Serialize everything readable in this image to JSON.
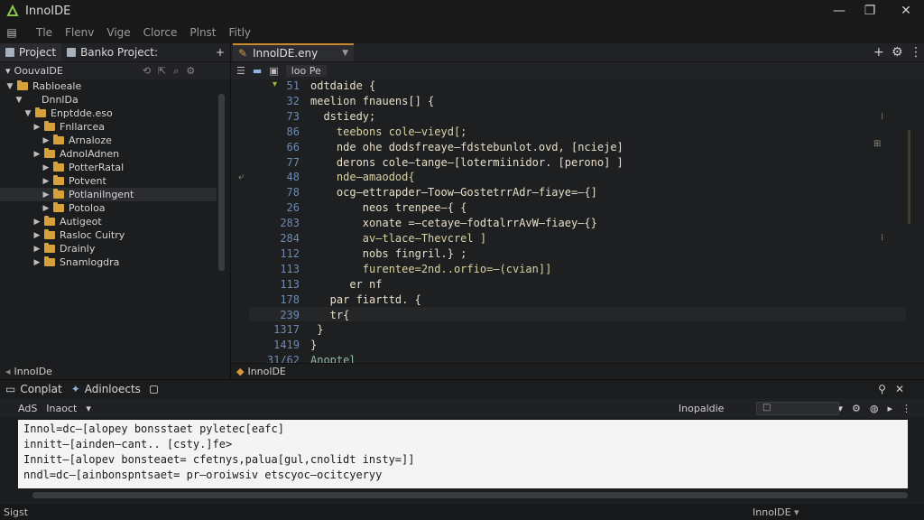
{
  "app": {
    "title": "InnoIDE"
  },
  "window": {
    "minimize": "—",
    "maximize": "❐",
    "close": "✕"
  },
  "menu": {
    "items": [
      "Tle",
      "Flenv",
      "Vige",
      "Clorce",
      "Plnst",
      "Fitly"
    ]
  },
  "left_panel": {
    "tabs": [
      {
        "label": "Project"
      },
      {
        "label": "Banko Project:"
      }
    ],
    "selector": "OouvaIDE",
    "tree": [
      {
        "label": "Rabloeale",
        "depth": 0,
        "arrow": "▼",
        "folder": true
      },
      {
        "label": "DnnlDa",
        "depth": 1,
        "arrow": "▼",
        "folder": false
      },
      {
        "label": "Enptdde.eso",
        "depth": 2,
        "arrow": "▼",
        "folder": true
      },
      {
        "label": "Fnllarcea",
        "depth": 3,
        "arrow": "▶",
        "folder": true
      },
      {
        "label": "Arnaloze",
        "depth": 4,
        "arrow": "▶",
        "folder": true
      },
      {
        "label": "AdnolAdnen",
        "depth": 3,
        "arrow": "▶",
        "folder": true
      },
      {
        "label": "PotterRatal",
        "depth": 4,
        "arrow": "▶",
        "folder": true
      },
      {
        "label": "Potvent",
        "depth": 4,
        "arrow": "▶",
        "folder": true
      },
      {
        "label": "PotlaniIngent",
        "depth": 4,
        "arrow": "▶",
        "folder": true
      },
      {
        "label": "Potoloa",
        "depth": 4,
        "arrow": "▶",
        "folder": true
      },
      {
        "label": "Autigeot",
        "depth": 3,
        "arrow": "▶",
        "folder": true
      },
      {
        "label": "Rasloc Cuitry",
        "depth": 3,
        "arrow": "▶",
        "folder": true
      },
      {
        "label": "Drainly",
        "depth": 3,
        "arrow": "▶",
        "folder": true
      },
      {
        "label": "Snamlogdra",
        "depth": 3,
        "arrow": "▶",
        "folder": true
      }
    ],
    "status": "InnoIDe"
  },
  "editor": {
    "tab": {
      "label": "InnolDE.eny"
    },
    "toolbar_pill": "loo Pe",
    "line_numbers": [
      "51",
      "32",
      "73",
      "86",
      "66",
      "77",
      "48",
      "78",
      "26",
      "283",
      "284",
      "112",
      "113",
      "113",
      "178",
      "239",
      "1317",
      "1419",
      "31/62"
    ],
    "lines": [
      "odtdaide {",
      "meelion fnauens[] {",
      "  dstiedy;",
      "    teebons cole—vieyd[;",
      "    nde ohe dodsfreaye—fdstebunlot.ovd, [ncieje]",
      "    derons cole—tange—[lotermiinidor. [perono] ]",
      "    nde—amaodod{",
      "    ocg—ettrapder—Toow—GostetrrAdr—fiaye=—{]",
      "        neos trenpee—{ {",
      "        xonate =—cetaye—fodtalrrAvW—fiaey—{}",
      "        av—tlace—Thevcrel ]",
      "        nobs fingril.} ;",
      "        furentee=2nd..orfio=—(cvian]]",
      "      er nf",
      "   par fiarttd. {",
      "   tr{",
      " }",
      "}",
      "Anoptel"
    ],
    "status": "InnolDE"
  },
  "bottom_panel": {
    "tabs": [
      {
        "label": "Conplat"
      },
      {
        "label": "Adinloects"
      }
    ],
    "toolbar": {
      "left1": "AdS",
      "left2": "Inaoct",
      "right": "Inopaldie"
    },
    "console": [
      "Innol=dc—[alopey bonsstaet pyletec[eafc]",
      "innitt—[ainden—cant.. [csty.]fe>",
      "Innitt—[alopev bonsteaet= cfetnys,palua[gul,cnolidt insty=]]",
      "nndl=dc—[ainbonspntsaet= pr—oroiwsiv etscyoc—ocitcyeryy"
    ]
  },
  "statusbar": {
    "left": "Sigst",
    "right": "InnoIDE"
  }
}
